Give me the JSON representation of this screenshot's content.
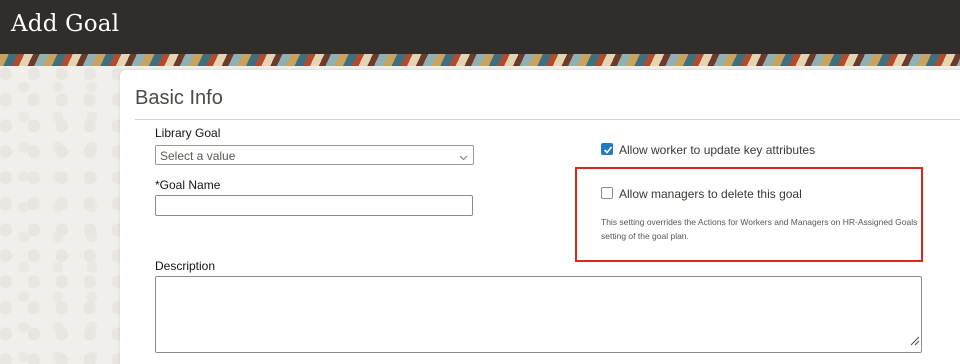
{
  "header": {
    "title": "Add Goal"
  },
  "section": {
    "title": "Basic Info"
  },
  "library_goal": {
    "label": "Library Goal",
    "placeholder": "Select a value"
  },
  "goal_name": {
    "required_mark": "*",
    "label": "Goal Name",
    "value": ""
  },
  "options": {
    "allow_worker_update": {
      "label": "Allow worker to update key attributes",
      "checked": true
    },
    "allow_managers_delete": {
      "label": "Allow managers to delete this goal",
      "checked": false,
      "hint": "This setting overrides the Actions for Workers and Managers on HR-Assigned Goals setting of the goal plan."
    }
  },
  "description": {
    "label": "Description",
    "value": ""
  },
  "colors": {
    "header_bg": "#312d2a",
    "checkbox_accent": "#227ac4",
    "highlight": "#e0251d"
  }
}
